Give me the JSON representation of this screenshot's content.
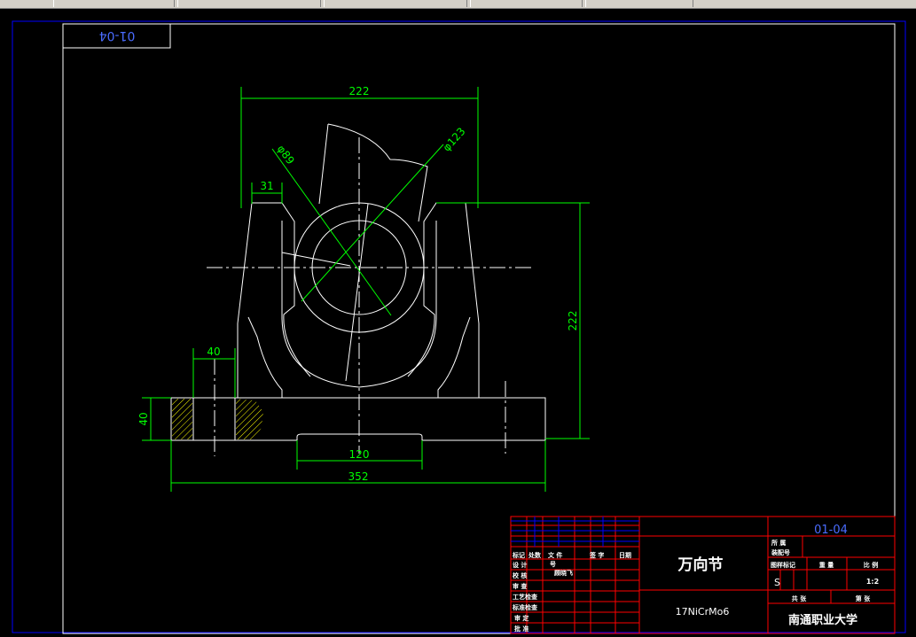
{
  "drawing_code_tag": "01-04",
  "drawing_code_box": "01-04",
  "part_name": "万向节",
  "material": "17NiCrMo6",
  "school": "南通职业大学",
  "scale": "1:2",
  "stage_mark": "S",
  "designer": "顾晓飞",
  "dimensions": {
    "top_width": "222",
    "dia_outer": "φ123",
    "dia_inner": "φ89",
    "ear_width": "31",
    "height_right": "222",
    "slot_width": "40",
    "base_height": "40",
    "bottom_recess": "120",
    "base_length": "352"
  },
  "title_block": {
    "rev_headers": [
      "标记",
      "处数",
      "文 件",
      "号",
      "签 字",
      "日期"
    ],
    "rows": [
      "设 计",
      "校 核",
      "审 查",
      "工艺检查",
      "标准检查",
      "审 定",
      "批 准"
    ],
    "right_top": [
      "所  属",
      "装配号"
    ],
    "stage_labels": [
      "图样标记",
      "重  量",
      "比  例"
    ],
    "sheet_labels": [
      "共   张",
      "第   张"
    ]
  },
  "colors": {
    "frame": "#0000ff",
    "geometry": "#ffffff",
    "dimension": "#00ff00",
    "title_grid": "#ff0000",
    "hatch": "#ffff00",
    "code_blue": "#4a6cff"
  }
}
